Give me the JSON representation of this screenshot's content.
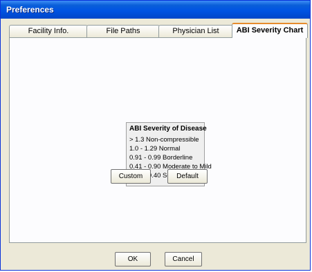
{
  "window": {
    "title": "Preferences"
  },
  "tabs": [
    {
      "label": "Facility Info.",
      "active": false
    },
    {
      "label": "File Paths",
      "active": false
    },
    {
      "label": "Physician List",
      "active": false
    },
    {
      "label": "ABI Severity Chart",
      "active": true
    }
  ],
  "severity_chart": {
    "title": "ABI Severity of Disease",
    "lines": [
      "> 1.3 Non-compressible",
      "1.0 - 1.29 Normal",
      "0.91 - 0.99 Borderline",
      "0.41 - 0.90 Moderate to Mild",
      "0.00 - 0.40  Severe"
    ]
  },
  "panel_buttons": {
    "custom": "Custom",
    "default": "Default"
  },
  "dialog_buttons": {
    "ok": "OK",
    "cancel": "Cancel"
  },
  "colors": {
    "titlebar": "#0054e3",
    "active_tab_accent": "#e68b2c",
    "dialog_bg": "#ece9d8"
  }
}
